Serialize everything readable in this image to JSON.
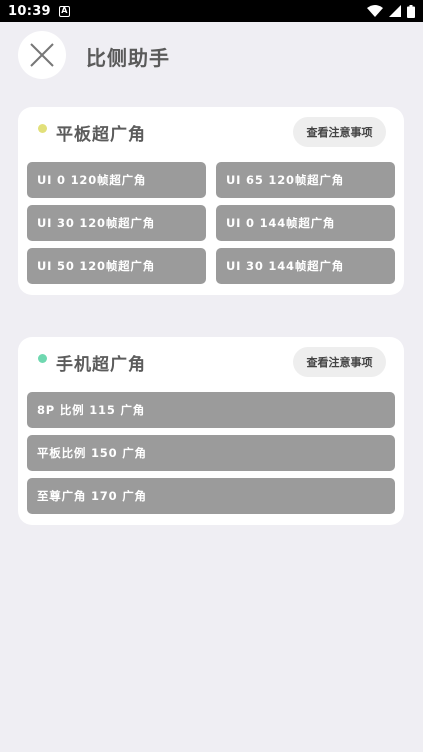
{
  "status_bar": {
    "time": "10:39",
    "notif_letter": "A"
  },
  "header": {
    "title": "比侧助手"
  },
  "colors": {
    "tablet_dot": "#e2e07a",
    "phone_dot": "#6fd8b0"
  },
  "tablet_section": {
    "title": "平板超广角",
    "notice_label": "查看注意事项",
    "options": [
      "UI 0 120帧超广角",
      "UI 65 120帧超广角",
      "UI 30 120帧超广角",
      "UI 0 144帧超广角",
      "UI 50 120帧超广角",
      "UI 30 144帧超广角"
    ]
  },
  "phone_section": {
    "title": "手机超广角",
    "notice_label": "查看注意事项",
    "options": [
      "8P 比例 115 广角",
      "平板比例 150 广角",
      "至尊广角 170 广角"
    ]
  }
}
